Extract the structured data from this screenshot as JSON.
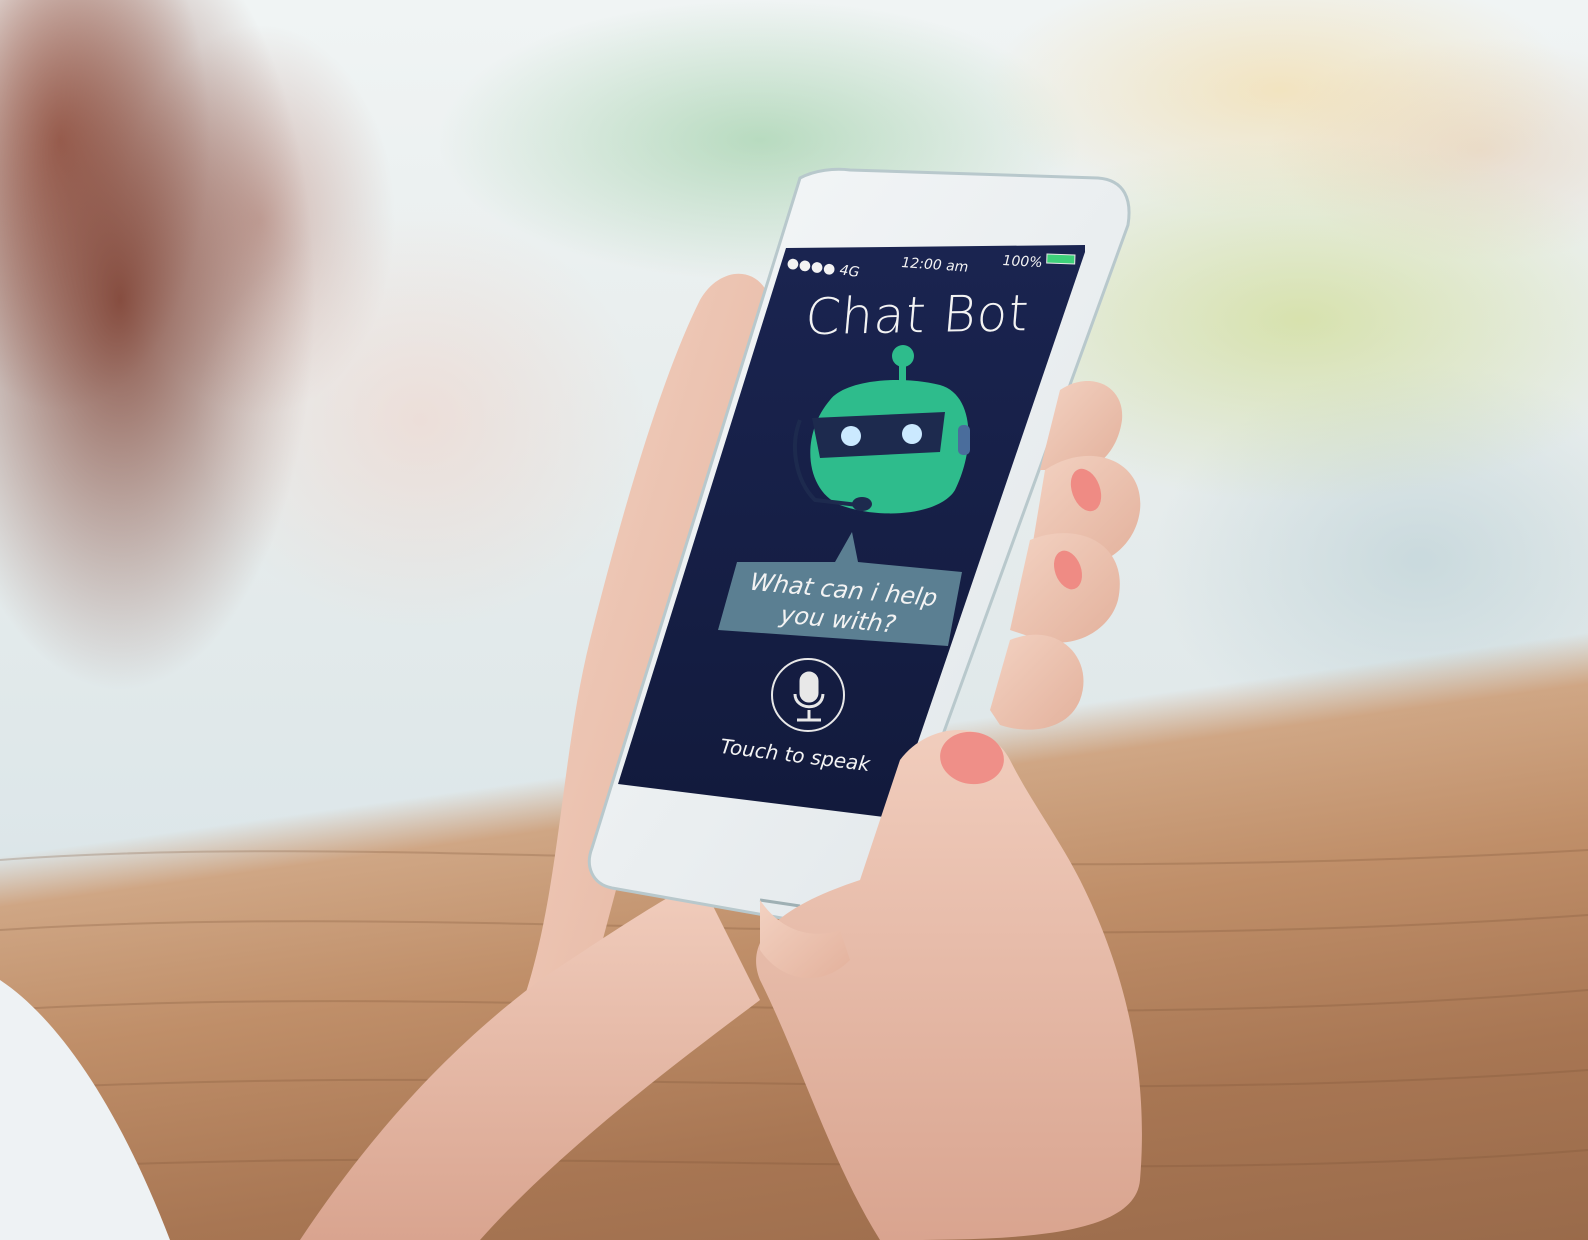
{
  "photo": {
    "subject": "hands holding smartphone showing chatbot app"
  },
  "status_bar": {
    "carrier": "●●●● 4G",
    "time": "12:00 am",
    "battery": "100%"
  },
  "app": {
    "title": "Chat Bot",
    "bubble_text": "What can i help you with?",
    "speak_label": "Touch to speak",
    "mic_icon": "microphone-icon",
    "robot_icon": "robot-head-icon",
    "colors": {
      "screen": "#16204a",
      "robot": "#2ebc8c",
      "bubble": "#5b7f92",
      "battery": "#3ed07a"
    }
  }
}
